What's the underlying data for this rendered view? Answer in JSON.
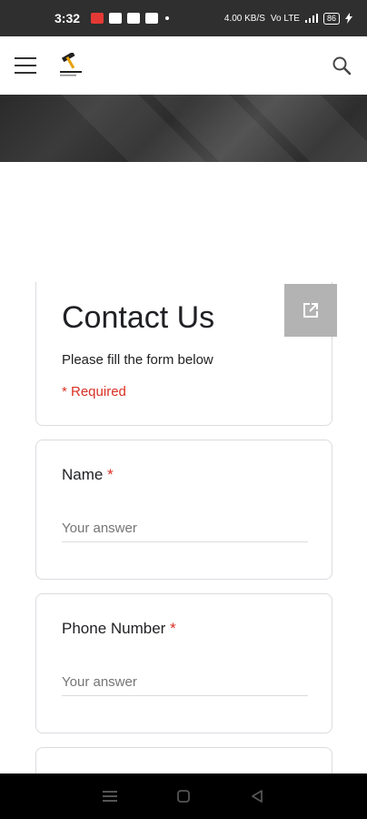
{
  "status_bar": {
    "time": "3:32",
    "network": "4.00 KB/S",
    "signal_label": "Vo LTE",
    "battery": "86"
  },
  "app_bar": {
    "menu_icon": "hamburger-menu-icon",
    "logo_icon": "hammer-logo-icon",
    "search_icon": "search-icon"
  },
  "form": {
    "title": "Contact Us",
    "description": "Please fill the form below",
    "required_note": "* Required",
    "open_icon": "open-in-new-icon",
    "questions": [
      {
        "label": "Name",
        "required_mark": "*",
        "placeholder": "Your answer"
      },
      {
        "label": "Phone Number",
        "required_mark": "*",
        "placeholder": "Your answer"
      }
    ]
  },
  "nav_bar": {
    "recent_icon": "recent-apps-icon",
    "home_icon": "home-icon",
    "back_icon": "back-icon"
  }
}
